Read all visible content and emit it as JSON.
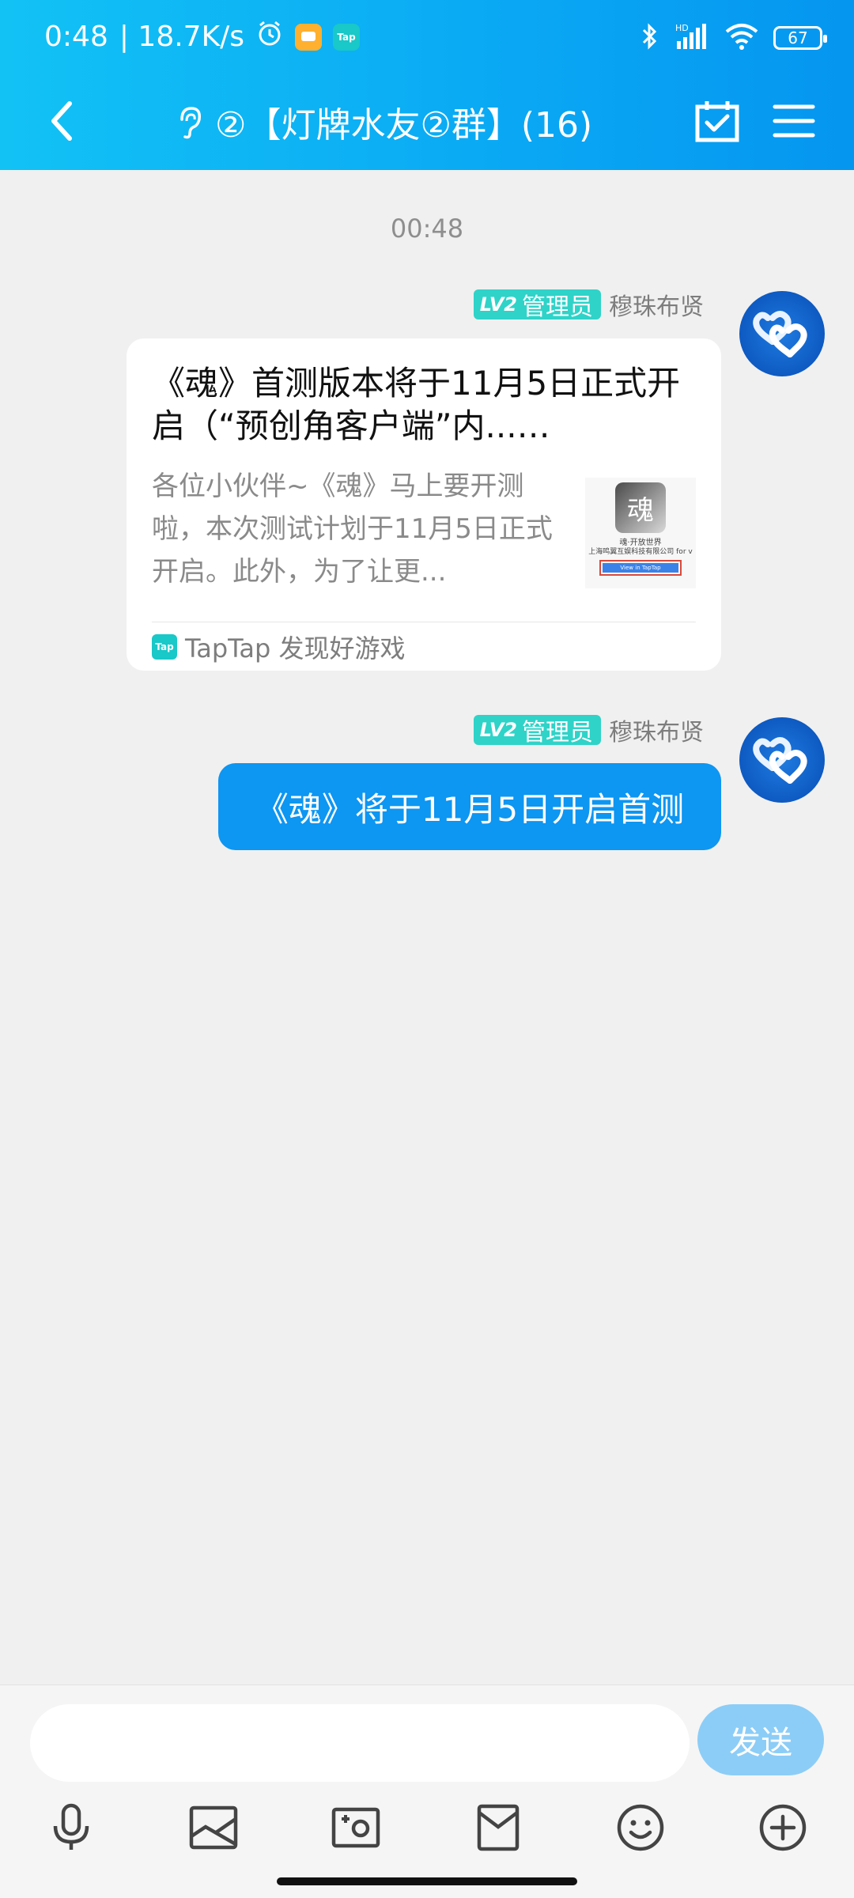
{
  "status_bar": {
    "time": "0:48",
    "net_speed": "| 18.7K/s",
    "tap_icon_text": "Tap",
    "hd_label": "HD",
    "battery": "67"
  },
  "nav": {
    "title": "②【灯牌水友②群】(16)"
  },
  "chat": {
    "timestamp": "00:48",
    "messages": [
      {
        "badge_level": "LV2",
        "badge_role": "管理员",
        "sender": "穆珠布贤",
        "card": {
          "title": "《魂》首测版本将于11月5日正式开启（“预创角客户端”内...…",
          "description": "各位小伙伴~《魂》马上要开测啦，本次测试计划于11月5日正式开启。此外，为了让更...",
          "thumb_logo": "魂",
          "thumb_line1": "魂·开放世界",
          "thumb_line2": "上海鸣翼互娱科技有限公司 for v",
          "thumb_button": "View in TapTap",
          "source_logo": "Tap",
          "source": "TapTap 发现好游戏"
        }
      },
      {
        "badge_level": "LV2",
        "badge_role": "管理员",
        "sender": "穆珠布贤",
        "text": "《魂》将于11月5日开启首测"
      }
    ]
  },
  "input": {
    "placeholder": "",
    "send_label": "发送"
  },
  "colors": {
    "header": "#0aa8f4",
    "bubble": "#0d96f2",
    "badge": "#2fd3c8",
    "send": "#8ccdf7"
  }
}
